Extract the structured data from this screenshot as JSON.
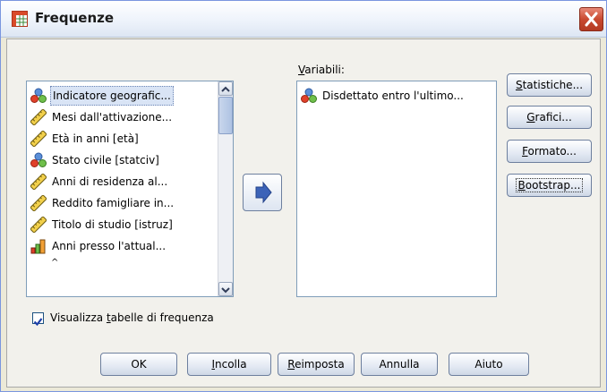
{
  "window": {
    "title": "Frequenze"
  },
  "source_list": {
    "items": [
      {
        "label": "Indicatore geografic...",
        "icon": "nominal-variable-icon"
      },
      {
        "label": "Mesi dall'attivazione...",
        "icon": "scale-variable-icon"
      },
      {
        "label": "Età in anni [età]",
        "icon": "scale-variable-icon"
      },
      {
        "label": "Stato civile [statciv]",
        "icon": "nominal-variable-icon"
      },
      {
        "label": "Anni di residenza al...",
        "icon": "scale-variable-icon"
      },
      {
        "label": "Reddito famigliare in...",
        "icon": "scale-variable-icon"
      },
      {
        "label": "Titolo di studio [istruz]",
        "icon": "scale-variable-icon"
      },
      {
        "label": "Anni presso l'attual...",
        "icon": "ordinal-variable-icon"
      }
    ]
  },
  "variables": {
    "label_pre": "",
    "label_hot": "V",
    "label_post": "ariabili:",
    "items": [
      {
        "label": "Disdettato entro l'ultimo...",
        "icon": "nominal-variable-icon"
      }
    ]
  },
  "side_buttons": [
    {
      "pre": "",
      "hot": "S",
      "post": "tatistiche..."
    },
    {
      "pre": "",
      "hot": "G",
      "post": "rafici..."
    },
    {
      "pre": "",
      "hot": "F",
      "post": "ormato..."
    },
    {
      "pre": "",
      "hot": "B",
      "post": "ootstrap..."
    }
  ],
  "checkbox": {
    "pre": "Visualizza ",
    "hot": "t",
    "post": "abelle di frequenza",
    "checked": true
  },
  "bottom_buttons": [
    {
      "pre": "OK",
      "hot": "",
      "post": ""
    },
    {
      "pre": "",
      "hot": "I",
      "post": "ncolla"
    },
    {
      "pre": "",
      "hot": "R",
      "post": "eimposta"
    },
    {
      "pre": "Annulla",
      "hot": "",
      "post": ""
    },
    {
      "pre": "Aiuto",
      "hot": "",
      "post": ""
    }
  ]
}
